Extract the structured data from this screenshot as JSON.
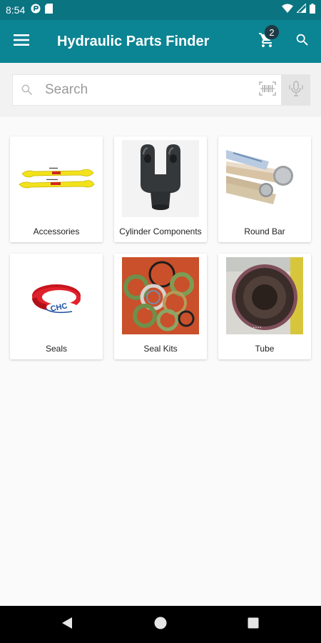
{
  "status_bar": {
    "time": "8:54",
    "left_icons": [
      "media-icon",
      "sd-card-icon"
    ],
    "right_icons": [
      "wifi-icon",
      "signal-icon",
      "battery-icon"
    ]
  },
  "app_bar": {
    "title": "Hydraulic Parts Finder",
    "cart_count": "2",
    "background_color": "#0b8493",
    "status_color": "#0a7481"
  },
  "search": {
    "placeholder": "Search",
    "value": ""
  },
  "categories": [
    {
      "label": "Accessories",
      "image": "yellow-lifting-slings"
    },
    {
      "label": "Cylinder Components",
      "image": "clevis-yoke"
    },
    {
      "label": "Round Bar",
      "image": "steel-round-bars"
    },
    {
      "label": "Seals",
      "image": "red-seal-ring"
    },
    {
      "label": "Seal Kits",
      "image": "o-ring-assortment"
    },
    {
      "label": "Tube",
      "image": "steel-tube-bore"
    }
  ],
  "nav_bar": {
    "buttons": [
      "back-icon",
      "home-icon",
      "recents-icon"
    ]
  }
}
